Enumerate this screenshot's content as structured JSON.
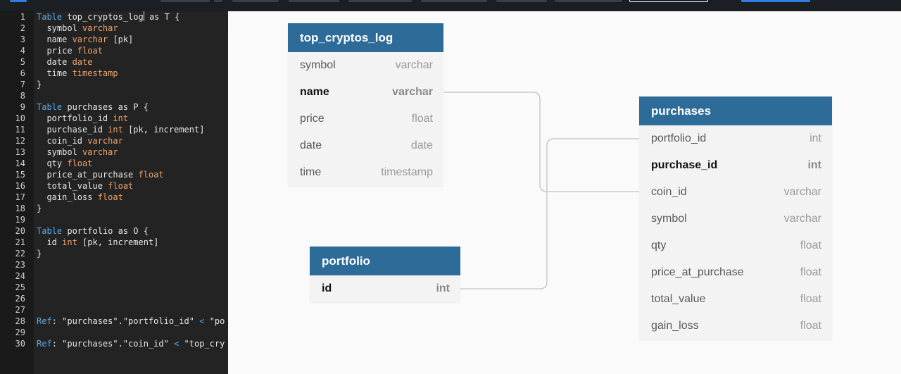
{
  "editor": {
    "lines": [
      {
        "n": "1",
        "tokens": [
          {
            "t": "Table",
            "c": "kw"
          },
          {
            "t": " top_cryptos_log",
            "c": ""
          },
          {
            "t": "",
            "c": "cursor"
          },
          {
            "t": " as T {",
            "c": ""
          }
        ]
      },
      {
        "n": "2",
        "tokens": [
          {
            "t": "  symbol ",
            "c": ""
          },
          {
            "t": "varchar",
            "c": "ty"
          }
        ]
      },
      {
        "n": "3",
        "tokens": [
          {
            "t": "  name ",
            "c": ""
          },
          {
            "t": "varchar",
            "c": "ty"
          },
          {
            "t": " [pk]",
            "c": ""
          }
        ]
      },
      {
        "n": "4",
        "tokens": [
          {
            "t": "  price ",
            "c": ""
          },
          {
            "t": "float",
            "c": "ty"
          }
        ]
      },
      {
        "n": "5",
        "tokens": [
          {
            "t": "  date ",
            "c": ""
          },
          {
            "t": "date",
            "c": "ty"
          }
        ]
      },
      {
        "n": "6",
        "tokens": [
          {
            "t": "  time ",
            "c": ""
          },
          {
            "t": "timestamp",
            "c": "ty"
          }
        ]
      },
      {
        "n": "7",
        "tokens": [
          {
            "t": "}",
            "c": ""
          }
        ]
      },
      {
        "n": "8",
        "tokens": []
      },
      {
        "n": "9",
        "tokens": [
          {
            "t": "Table",
            "c": "kw"
          },
          {
            "t": " purchases as P {",
            "c": ""
          }
        ]
      },
      {
        "n": "10",
        "tokens": [
          {
            "t": "  portfolio_id ",
            "c": ""
          },
          {
            "t": "int",
            "c": "ty"
          }
        ]
      },
      {
        "n": "11",
        "tokens": [
          {
            "t": "  purchase_id ",
            "c": ""
          },
          {
            "t": "int",
            "c": "ty"
          },
          {
            "t": " [pk, increment]",
            "c": ""
          }
        ]
      },
      {
        "n": "12",
        "tokens": [
          {
            "t": "  coin_id ",
            "c": ""
          },
          {
            "t": "varchar",
            "c": "ty"
          }
        ]
      },
      {
        "n": "13",
        "tokens": [
          {
            "t": "  symbol ",
            "c": ""
          },
          {
            "t": "varchar",
            "c": "ty"
          }
        ]
      },
      {
        "n": "14",
        "tokens": [
          {
            "t": "  qty ",
            "c": ""
          },
          {
            "t": "float",
            "c": "ty"
          }
        ]
      },
      {
        "n": "15",
        "tokens": [
          {
            "t": "  price_at_purchase ",
            "c": ""
          },
          {
            "t": "float",
            "c": "ty"
          }
        ]
      },
      {
        "n": "16",
        "tokens": [
          {
            "t": "  total_value ",
            "c": ""
          },
          {
            "t": "float",
            "c": "ty"
          }
        ]
      },
      {
        "n": "17",
        "tokens": [
          {
            "t": "  gain_loss ",
            "c": ""
          },
          {
            "t": "float",
            "c": "ty"
          }
        ]
      },
      {
        "n": "18",
        "tokens": [
          {
            "t": "}",
            "c": ""
          }
        ]
      },
      {
        "n": "19",
        "tokens": []
      },
      {
        "n": "20",
        "tokens": [
          {
            "t": "Table",
            "c": "kw"
          },
          {
            "t": " portfolio as O {",
            "c": ""
          }
        ]
      },
      {
        "n": "21",
        "tokens": [
          {
            "t": "  id ",
            "c": ""
          },
          {
            "t": "int",
            "c": "ty"
          },
          {
            "t": " [pk, increment]",
            "c": ""
          }
        ]
      },
      {
        "n": "22",
        "tokens": [
          {
            "t": "}",
            "c": ""
          }
        ]
      },
      {
        "n": "23",
        "tokens": []
      },
      {
        "n": "24",
        "tokens": []
      },
      {
        "n": "25",
        "tokens": []
      },
      {
        "n": "26",
        "tokens": []
      },
      {
        "n": "27",
        "tokens": []
      },
      {
        "n": "28",
        "tokens": [
          {
            "t": "Ref",
            "c": "kw"
          },
          {
            "t": ": \"purchases\".\"portfolio_id\" ",
            "c": ""
          },
          {
            "t": "<",
            "c": "kw"
          },
          {
            "t": " \"po",
            "c": ""
          }
        ]
      },
      {
        "n": "29",
        "tokens": []
      },
      {
        "n": "30",
        "tokens": [
          {
            "t": "Ref",
            "c": "kw"
          },
          {
            "t": ": \"purchases\".\"coin_id\" ",
            "c": ""
          },
          {
            "t": "<",
            "c": "kw"
          },
          {
            "t": " \"top_cry",
            "c": ""
          }
        ]
      }
    ]
  },
  "collapse_glyph": "‹",
  "tables": {
    "top_cryptos_log": {
      "name": "top_cryptos_log",
      "columns": [
        {
          "name": "symbol",
          "type": "varchar",
          "pk": false
        },
        {
          "name": "name",
          "type": "varchar",
          "pk": true
        },
        {
          "name": "price",
          "type": "float",
          "pk": false
        },
        {
          "name": "date",
          "type": "date",
          "pk": false
        },
        {
          "name": "time",
          "type": "timestamp",
          "pk": false
        }
      ]
    },
    "purchases": {
      "name": "purchases",
      "columns": [
        {
          "name": "portfolio_id",
          "type": "int",
          "pk": false
        },
        {
          "name": "purchase_id",
          "type": "int",
          "pk": true
        },
        {
          "name": "coin_id",
          "type": "varchar",
          "pk": false
        },
        {
          "name": "symbol",
          "type": "varchar",
          "pk": false
        },
        {
          "name": "qty",
          "type": "float",
          "pk": false
        },
        {
          "name": "price_at_purchase",
          "type": "float",
          "pk": false
        },
        {
          "name": "total_value",
          "type": "float",
          "pk": false
        },
        {
          "name": "gain_loss",
          "type": "float",
          "pk": false
        }
      ]
    },
    "portfolio": {
      "name": "portfolio",
      "columns": [
        {
          "name": "id",
          "type": "int",
          "pk": true
        }
      ]
    }
  },
  "colors": {
    "table_header": "#2d6b99",
    "keyword": "#5aa9ea",
    "type": "#f0a36c",
    "link": "#c9c9c9"
  }
}
